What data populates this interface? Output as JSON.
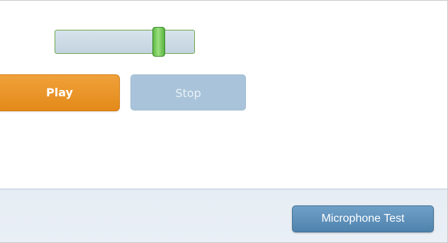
{
  "volume_slider": {
    "level": 0.74
  },
  "controls": {
    "play_label": "Play",
    "stop_label": "Stop",
    "stop_enabled": false
  },
  "footer": {
    "microphone_test_label": "Microphone Test"
  },
  "colors": {
    "play_accent": "#e38a1a",
    "slider_thumb": "#5cb845",
    "stop_disabled": "#a9c4da",
    "mic_button": "#4f83ad"
  }
}
